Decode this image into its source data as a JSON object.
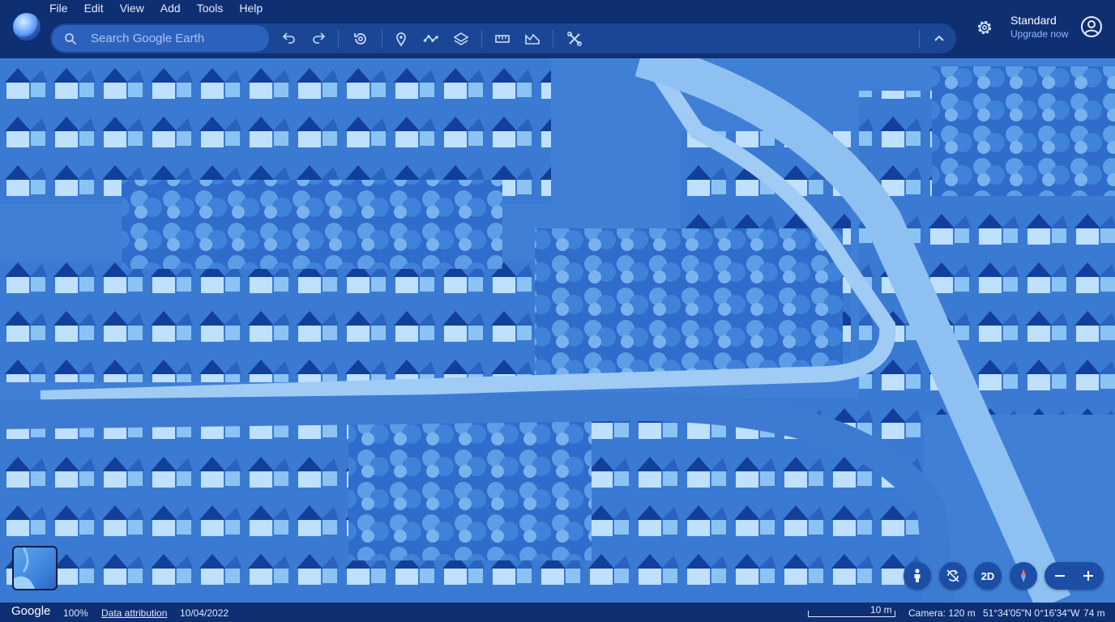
{
  "app": {
    "name": "Google Earth",
    "menu": [
      "File",
      "Edit",
      "View",
      "Add",
      "Tools",
      "Help"
    ]
  },
  "search": {
    "placeholder": "Search Google Earth",
    "value": ""
  },
  "toolbar": {
    "buttons": [
      "undo-icon",
      "redo-icon",
      "history-icon",
      "placemark-icon",
      "path-icon",
      "layers-icon",
      "ruler-icon",
      "elevation-icon",
      "tools-icon"
    ],
    "collapse_icon": "chevron-up-icon"
  },
  "account": {
    "settings_icon": "gear-icon",
    "plan": "Standard",
    "upgrade": "Upgrade now",
    "account_icon": "account-icon"
  },
  "map_controls": {
    "street_view_icon": "pegman-icon",
    "reset_icon": "rotate-icon",
    "mode_button": "2D",
    "compass_icon": "compass-icon",
    "zoom_out": "−",
    "zoom_in": "+"
  },
  "status": {
    "brand": "Google",
    "zoom": "100%",
    "attribution": "Data attribution",
    "imagery_date": "10/04/2022",
    "scale_label": "10 m",
    "camera": "Camera: 120 m",
    "coordinates": "51°34'05\"N 0°16'34\"W",
    "elevation": "74 m"
  },
  "theme": {
    "bar": "#0f2f73",
    "toolbar": "#1b4696",
    "accent": "#8fb6ff",
    "map_base": "#3f7fd6"
  }
}
